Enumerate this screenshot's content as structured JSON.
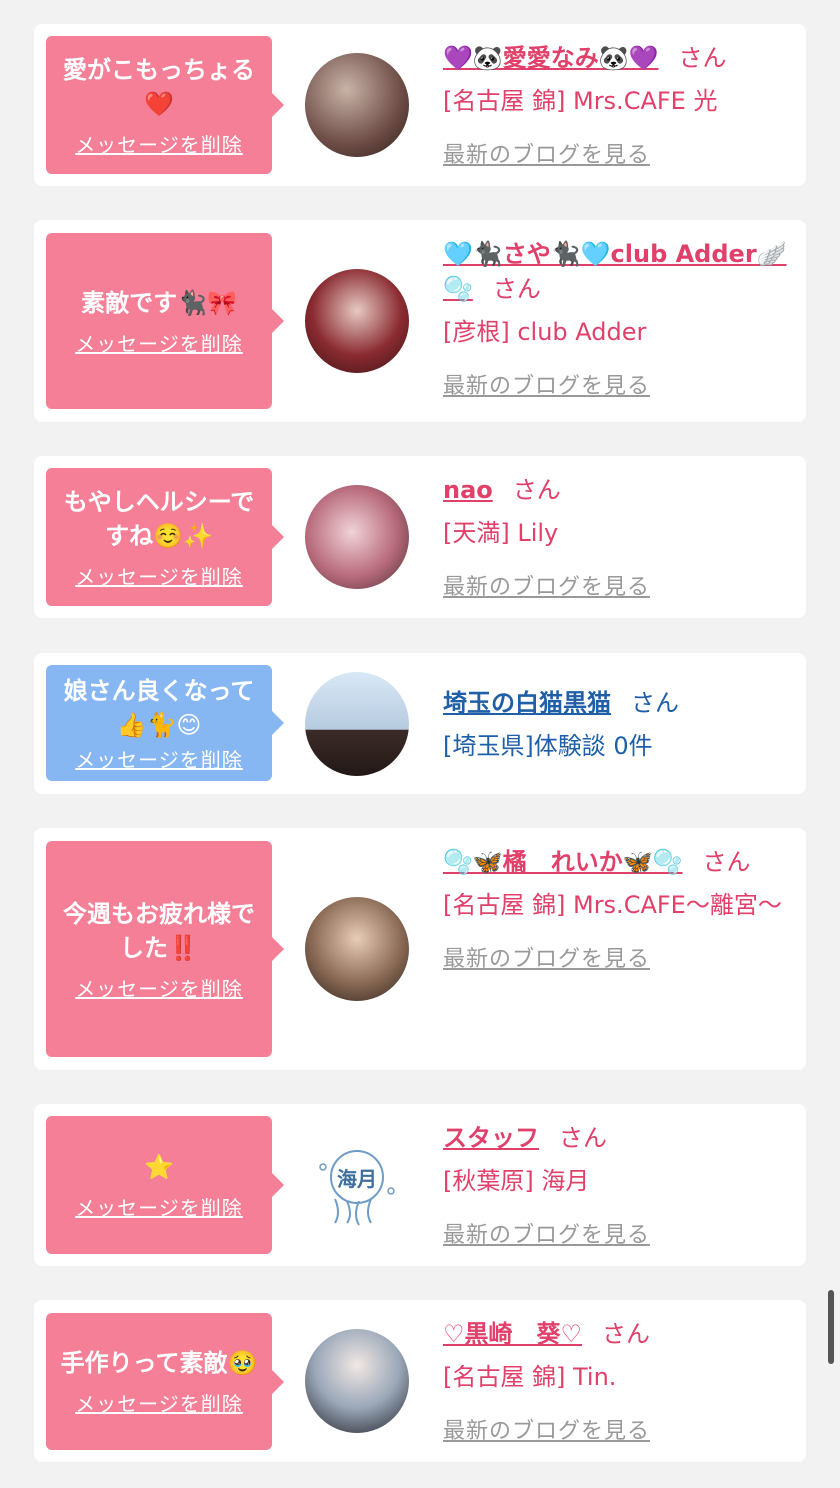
{
  "delete_label": "メッセージを削除",
  "blog_label": "最新のブログを見る",
  "san_label": "さん",
  "colors": {
    "pink_bubble": "#f47f96",
    "blue_bubble": "#86b7f3",
    "name_pink": "#e0406a",
    "name_blue": "#1f5fa8"
  },
  "items": [
    {
      "message": "愛がこもっちょる❤️",
      "bubble": "pink",
      "name": "💜🐼愛愛なみ🐼💜",
      "shop": "[名古屋 錦] Mrs.CAFE 光",
      "has_blog": true,
      "avatar": "avatar-photo"
    },
    {
      "message": "素敵です🐈‍⬛🎀",
      "bubble": "pink",
      "name": "🩵🐈‍⬛さや🐈‍⬛🩵club Adder🪽🫧",
      "shop": "[彦根] club Adder",
      "has_blog": true,
      "avatar": "avatar-photo"
    },
    {
      "message": "もやしヘルシーですね☺️✨",
      "bubble": "pink",
      "name": "nao",
      "shop": "[天満] Lily",
      "has_blog": true,
      "avatar": "avatar-photo"
    },
    {
      "message": "娘さん良くなって👍🐈😊",
      "bubble": "blue",
      "name": "埼玉の白猫黒猫",
      "shop": "[埼玉県]体験談 0件",
      "has_blog": false,
      "avatar": "avatar-photo"
    },
    {
      "message": "今週もお疲れ様でした‼️",
      "bubble": "pink",
      "name": "🫧🦋橘　れいか🦋🫧",
      "shop": "[名古屋 錦] Mrs.CAFE〜離宮〜",
      "has_blog": true,
      "avatar": "avatar-photo"
    },
    {
      "message": "⭐️",
      "bubble": "pink",
      "name": "スタッフ",
      "shop": "[秋葉原] 海月",
      "has_blog": true,
      "avatar": "海月"
    },
    {
      "message": "手作りって素敵🥹",
      "bubble": "pink",
      "name": "♡黒崎　葵♡",
      "shop": "[名古屋 錦] Tin.",
      "has_blog": true,
      "avatar": "avatar-photo"
    }
  ]
}
